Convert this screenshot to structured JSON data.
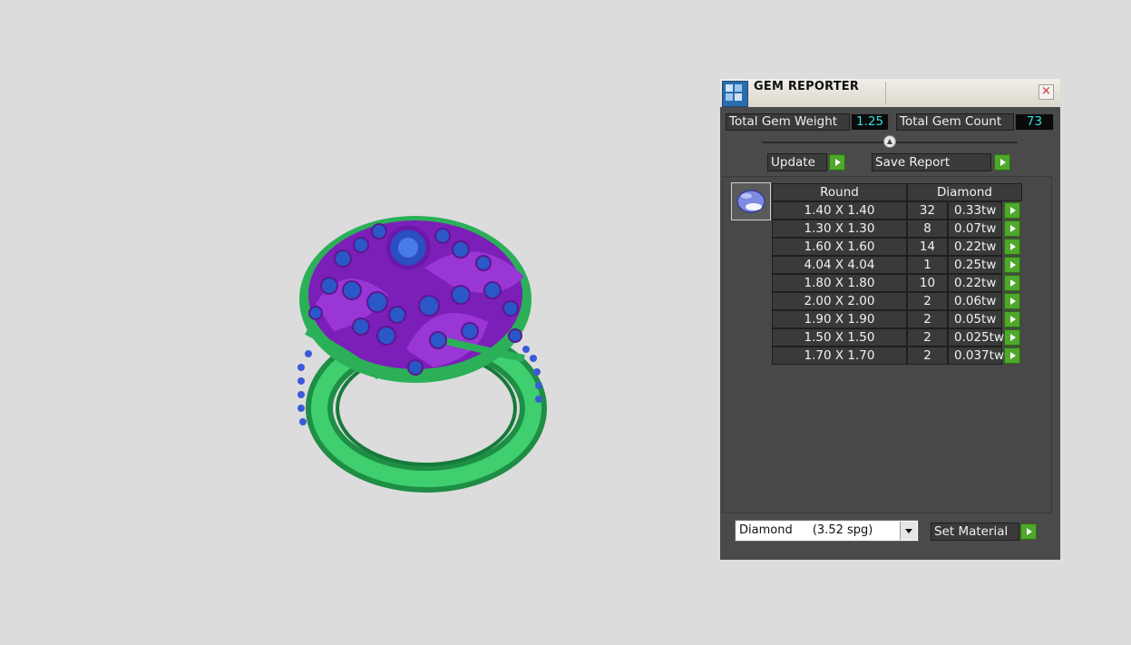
{
  "viewport": {
    "object": "3D ring model"
  },
  "panel": {
    "title": "GEM REPORTER",
    "close_icon": "×",
    "total_weight_label": "Total Gem Weight",
    "total_weight_value": "1.25",
    "total_count_label": "Total Gem Count",
    "total_count_value": "73",
    "update_label": "Update",
    "save_report_label": "Save Report",
    "table": {
      "headers": {
        "shape": "Round",
        "material": "Diamond"
      },
      "rows": [
        {
          "size": "1.40 X 1.40",
          "count": "32",
          "weight": "0.33tw"
        },
        {
          "size": "1.30 X 1.30",
          "count": "8",
          "weight": "0.07tw"
        },
        {
          "size": "1.60 X 1.60",
          "count": "14",
          "weight": "0.22tw"
        },
        {
          "size": "4.04 X 4.04",
          "count": "1",
          "weight": "0.25tw"
        },
        {
          "size": "1.80 X 1.80",
          "count": "10",
          "weight": "0.22tw"
        },
        {
          "size": "2.00 X 2.00",
          "count": "2",
          "weight": "0.06tw"
        },
        {
          "size": "1.90 X 1.90",
          "count": "2",
          "weight": "0.05tw"
        },
        {
          "size": "1.50 X 1.50",
          "count": "2",
          "weight": "0.025tw"
        },
        {
          "size": "1.70 X 1.70",
          "count": "2",
          "weight": "0.037tw"
        }
      ]
    },
    "material_select": {
      "name": "Diamond",
      "gravity": "(3.52 spg)"
    },
    "set_material_label": "Set Material"
  },
  "colors": {
    "accent_green": "#4ea82a",
    "value_cyan": "#33e0e0",
    "ring_metal_green": "#2fb35a",
    "ring_setting_purple": "#8a2bc2",
    "gem_blue": "#2a58c8"
  }
}
